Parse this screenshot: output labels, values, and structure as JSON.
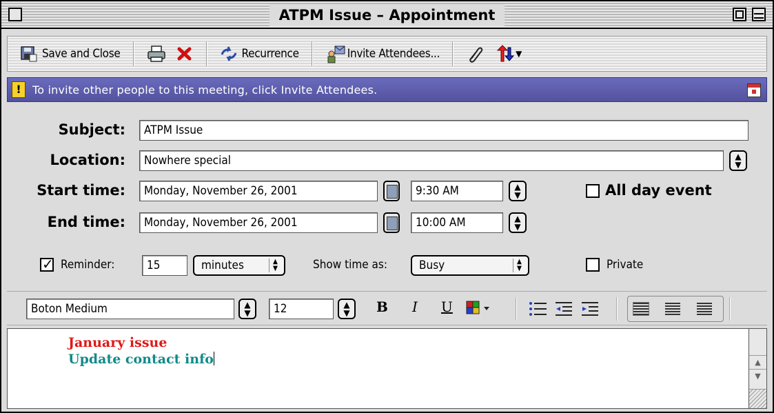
{
  "window": {
    "title": "ATPM Issue – Appointment"
  },
  "toolbar": {
    "save_close": "Save and Close",
    "recurrence": "Recurrence",
    "invite": "Invite Attendees..."
  },
  "info_bar": {
    "message": "To invite other people to this meeting, click Invite Attendees."
  },
  "form": {
    "subject_label": "Subject:",
    "subject_value": "ATPM Issue",
    "location_label": "Location:",
    "location_value": "Nowhere special",
    "start_label": "Start time:",
    "start_date": "Monday, November 26, 2001",
    "start_time": "9:30 AM",
    "end_label": "End time:",
    "end_date": "Monday, November 26, 2001",
    "end_time": "10:00 AM",
    "all_day_label": "All day event",
    "all_day_checked": false,
    "reminder_label": "Reminder:",
    "reminder_checked": true,
    "reminder_value": "15",
    "reminder_unit": "minutes",
    "show_time_label": "Show time as:",
    "show_time_value": "Busy",
    "private_label": "Private",
    "private_checked": false
  },
  "format_bar": {
    "font": "Boton Medium",
    "size": "12",
    "bold": "B",
    "italic": "I",
    "underline": "U"
  },
  "body": {
    "line1": "January issue",
    "line2": "Update contact info"
  },
  "colors": {
    "info_bar": "#5a5aa8",
    "text_red": "#e01818",
    "text_teal": "#128a8a"
  }
}
